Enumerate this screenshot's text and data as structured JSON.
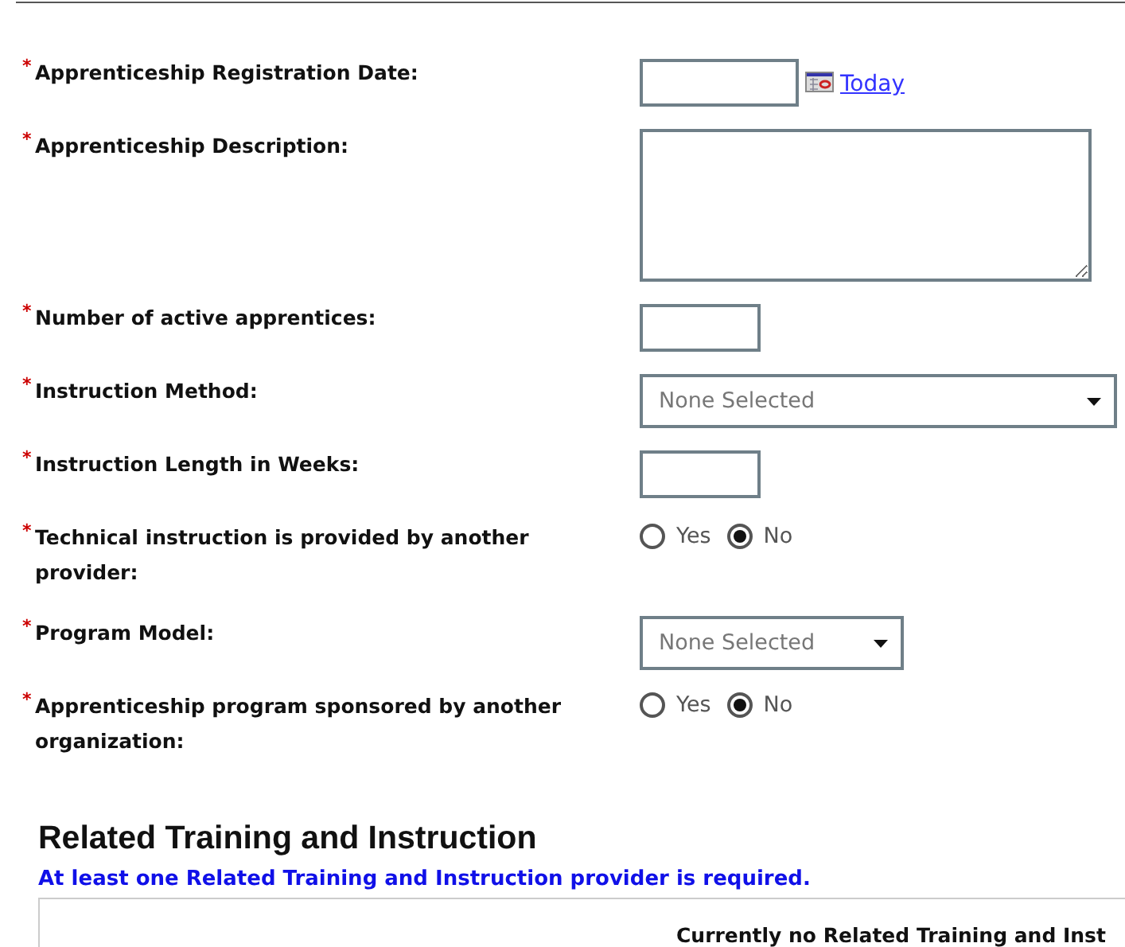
{
  "fields": [
    {
      "label": "Apprenticeship Registration Date:",
      "marker": "*",
      "kind": "date",
      "link": "Today"
    },
    {
      "label": "Apprenticeship Description:",
      "marker": "*",
      "kind": "textarea"
    },
    {
      "label": "Number of active apprentices:",
      "marker": "*",
      "kind": "short"
    },
    {
      "label": "Instruction Method:",
      "marker": "*",
      "kind": "select",
      "wide": true,
      "placeholder": "None Selected"
    },
    {
      "label": "Instruction Length in Weeks:",
      "marker": "*",
      "kind": "short"
    },
    {
      "label": "Technical instruction is provided by another provider:",
      "marker": "*",
      "kind": "radio",
      "options": [
        {
          "label": "Yes",
          "selected": false
        },
        {
          "label": "No",
          "selected": true
        }
      ]
    },
    {
      "label": "Program Model:",
      "marker": "*",
      "kind": "select",
      "wide": false,
      "placeholder": "None Selected"
    },
    {
      "label": "Apprenticeship program sponsored by another organization:",
      "marker": "*",
      "kind": "radio",
      "options": [
        {
          "label": "Yes",
          "selected": false
        },
        {
          "label": "No",
          "selected": true
        }
      ]
    }
  ],
  "related": {
    "title": "Related Training and Instruction",
    "notice": "At least one Related Training and Instruction provider is required.",
    "empty_message": "Currently no Related Training and Inst"
  }
}
